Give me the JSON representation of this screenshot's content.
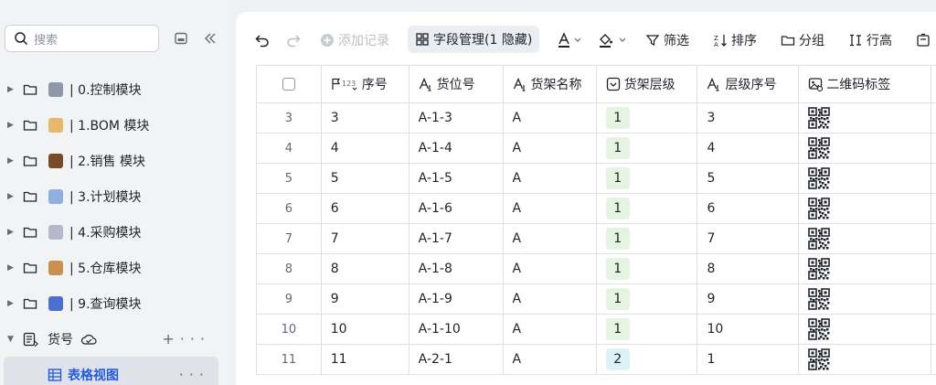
{
  "sidebar": {
    "search_placeholder": "搜索",
    "items": [
      {
        "label": "| 0.控制模块",
        "emoji_color": "#8e99a8"
      },
      {
        "label": "| 1.BOM 模块",
        "emoji_color": "#e8b86a"
      },
      {
        "label": "| 2.销售 模块",
        "emoji_color": "#7a4a2b"
      },
      {
        "label": "| 3.计划模块",
        "emoji_color": "#8db0e0"
      },
      {
        "label": "| 4.采购模块",
        "emoji_color": "#b5b8c8"
      },
      {
        "label": "| 5.仓库模块",
        "emoji_color": "#c99050"
      },
      {
        "label": "| 9.查询模块",
        "emoji_color": "#4a6fd1"
      }
    ],
    "table_node": {
      "label": "货号"
    },
    "view_node": {
      "label": "表格视图"
    }
  },
  "toolbar": {
    "add_record": "添加记录",
    "field_manage": "字段管理(1 隐藏)",
    "filter": "筛选",
    "sort": "排序",
    "group": "分组",
    "row_height": "行高"
  },
  "grid": {
    "columns": [
      "序号",
      "货位号",
      "货架名称",
      "货架层级",
      "层级序号",
      "二维码标签"
    ],
    "rows": [
      {
        "idx": "3",
        "seq": "3",
        "loc": "A-1-3",
        "shelf": "A",
        "level": "1",
        "lvlseq": "3"
      },
      {
        "idx": "4",
        "seq": "4",
        "loc": "A-1-4",
        "shelf": "A",
        "level": "1",
        "lvlseq": "4"
      },
      {
        "idx": "5",
        "seq": "5",
        "loc": "A-1-5",
        "shelf": "A",
        "level": "1",
        "lvlseq": "5"
      },
      {
        "idx": "6",
        "seq": "6",
        "loc": "A-1-6",
        "shelf": "A",
        "level": "1",
        "lvlseq": "6"
      },
      {
        "idx": "7",
        "seq": "7",
        "loc": "A-1-7",
        "shelf": "A",
        "level": "1",
        "lvlseq": "7"
      },
      {
        "idx": "8",
        "seq": "8",
        "loc": "A-1-8",
        "shelf": "A",
        "level": "1",
        "lvlseq": "8"
      },
      {
        "idx": "9",
        "seq": "9",
        "loc": "A-1-9",
        "shelf": "A",
        "level": "1",
        "lvlseq": "9"
      },
      {
        "idx": "10",
        "seq": "10",
        "loc": "A-1-10",
        "shelf": "A",
        "level": "1",
        "lvlseq": "10"
      },
      {
        "idx": "11",
        "seq": "11",
        "loc": "A-2-1",
        "shelf": "A",
        "level": "2",
        "lvlseq": "1"
      }
    ]
  }
}
